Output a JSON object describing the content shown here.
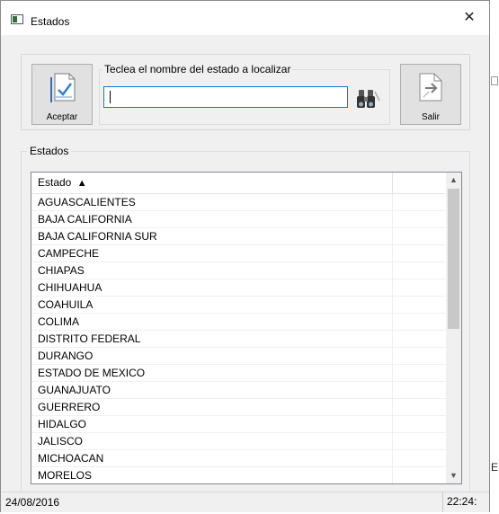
{
  "window": {
    "title": "Estados",
    "close_glyph": "✕"
  },
  "toolbar": {
    "accept_label": "Aceptar",
    "exit_label": "Salir",
    "search_legend": "Teclea el nombre del estado a localizar",
    "search_value": ""
  },
  "list": {
    "group_label": "Estados",
    "column_header": "Estado",
    "sort_indicator": "▲",
    "items": [
      "AGUASCALIENTES",
      "BAJA CALIFORNIA",
      "BAJA CALIFORNIA SUR",
      "CAMPECHE",
      "CHIAPAS",
      "CHIHUAHUA",
      "COAHUILA",
      "COLIMA",
      "DISTRITO FEDERAL",
      "DURANGO",
      "ESTADO DE MEXICO",
      "GUANAJUATO",
      "GUERRERO",
      "HIDALGO",
      "JALISCO",
      "MICHOACAN",
      "MORELOS"
    ]
  },
  "status": {
    "date": "24/08/2016",
    "time": "22:24:"
  },
  "background": {
    "edge_letter": "E"
  },
  "icons": {
    "accept": "document-check-icon",
    "exit": "document-arrow-icon",
    "search": "binoculars-icon",
    "scroll_up": "chevron-up-icon",
    "scroll_down": "chevron-down-icon"
  }
}
